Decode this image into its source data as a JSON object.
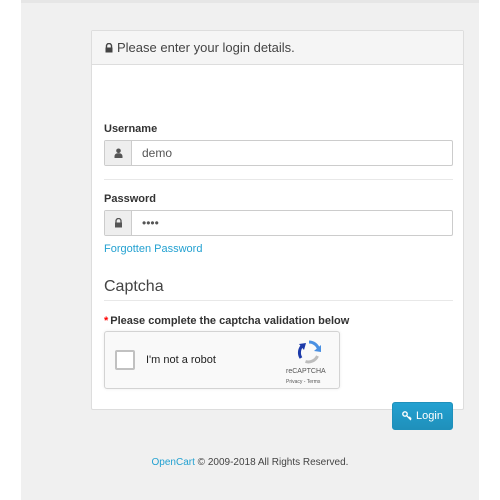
{
  "panel": {
    "heading": "Please enter your login details.",
    "username_label": "Username",
    "username_value": "demo",
    "password_label": "Password",
    "password_value": "demo",
    "forgotten_link": "Forgotten Password",
    "captcha_title": "Captcha",
    "captcha_required_text": "Please complete the captcha validation below",
    "captcha_checkbox_text": "I'm not a robot",
    "recaptcha_brand": "reCAPTCHA",
    "recaptcha_links": "Privacy - Terms",
    "login_button": "Login"
  },
  "footer": {
    "brand_link": "OpenCart",
    "copyright": "© 2009-2018 All Rights Reserved."
  },
  "icons": {
    "heading": "lock-icon",
    "username_addon": "user-icon",
    "password_addon": "lock-icon",
    "login_button": "key-icon"
  },
  "colors": {
    "link": "#23a1d1",
    "button": "#229ac8",
    "required_star": "#ff0000"
  }
}
